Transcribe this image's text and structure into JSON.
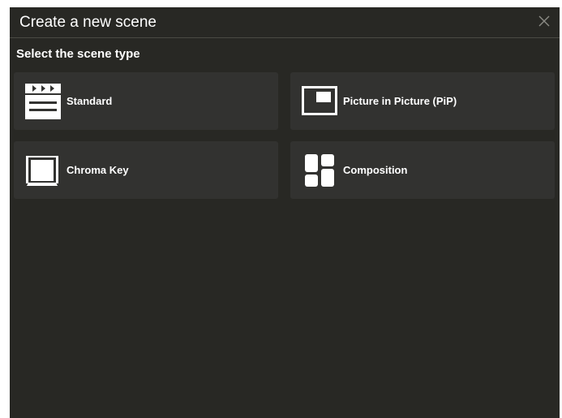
{
  "dialog": {
    "title": "Create a new scene",
    "close_icon": "close-icon",
    "subtitle": "Select the scene type"
  },
  "scene_types": [
    {
      "label": "Standard",
      "icon": "clapperboard-icon"
    },
    {
      "label": "Picture in Picture (PiP)",
      "icon": "picture-in-picture-icon"
    },
    {
      "label": "Chroma Key",
      "icon": "green-screen-icon"
    },
    {
      "label": "Composition",
      "icon": "composition-grid-icon"
    }
  ],
  "colors": {
    "dialog_bg": "#282824",
    "tile_bg": "#323230",
    "text": "#ffffff"
  }
}
